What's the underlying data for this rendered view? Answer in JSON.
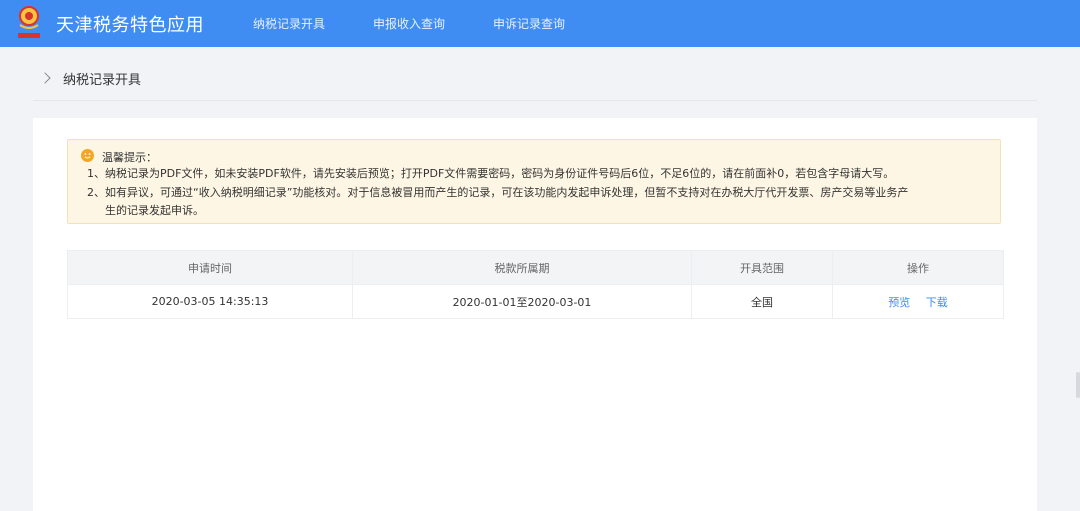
{
  "header": {
    "app_title": "天津税务特色应用",
    "logo_icon": "tax-emblem-icon",
    "accent_color": "#3f8cf3",
    "nav": [
      {
        "label": "纳税记录开具"
      },
      {
        "label": "申报收入查询"
      },
      {
        "label": "申诉记录查询"
      }
    ]
  },
  "breadcrumb": {
    "current": "纳税记录开具"
  },
  "notice": {
    "title": "温馨提示：",
    "line1": "1、纳税记录为PDF文件，如未安装PDF软件，请先安装后预览；打开PDF文件需要密码，密码为身份证件号码后6位，不足6位的，请在前面补0，若包含字母请大写。",
    "line2": "2、如有异议，可通过“收入纳税明细记录”功能核对。对于信息被冒用而产生的记录，可在该功能内发起申诉处理，但暂不支持对在办税大厅代开发票、房产交易等业务产",
    "line3": "生的记录发起申诉。"
  },
  "table": {
    "headers": [
      "申请时间",
      "税款所属期",
      "开具范围",
      "操作"
    ],
    "rows": [
      {
        "apply_time": "2020-03-05 14:35:13",
        "tax_period": "2020-01-01至2020-03-01",
        "scope": "全国",
        "actions": [
          "预览",
          "下载"
        ]
      }
    ]
  }
}
